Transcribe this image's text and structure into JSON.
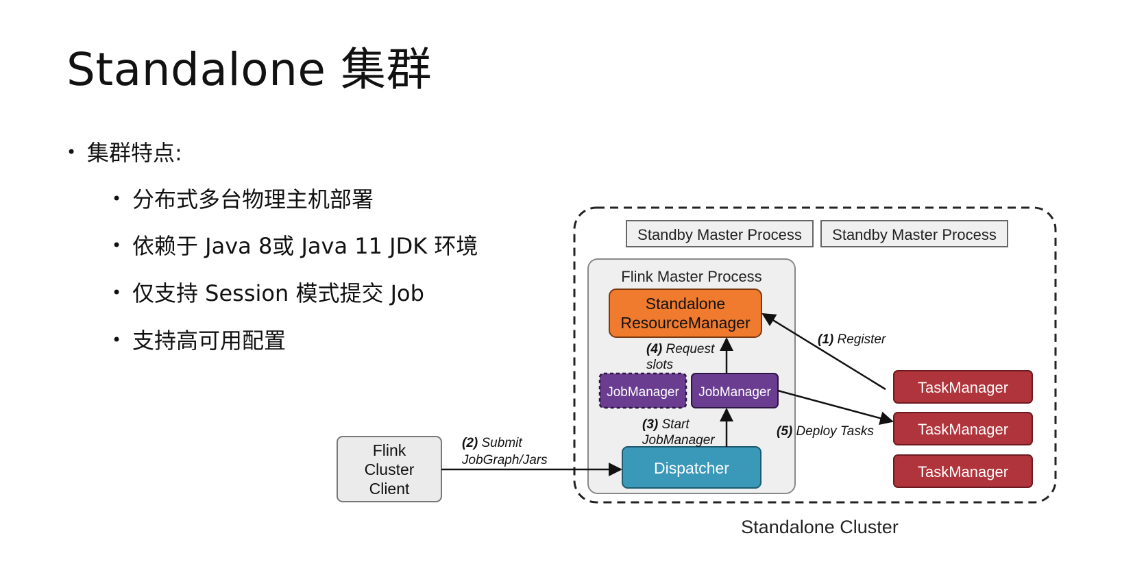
{
  "slide": {
    "title": "Standalone 集群",
    "bullets": [
      {
        "level": 1,
        "text": "集群特点:"
      },
      {
        "level": 2,
        "text": "分布式多台物理主机部署"
      },
      {
        "level": 2,
        "text": "依赖于 Java 8或 Java 11 JDK 环境"
      },
      {
        "level": 2,
        "text": "仅支持 Session 模式提交 Job"
      },
      {
        "level": 2,
        "text": "支持高可用配置"
      }
    ]
  },
  "diagram": {
    "cluster_label": "Standalone Cluster",
    "standby_1": "Standby Master Process",
    "standby_2": "Standby Master Process",
    "master_label": "Flink Master Process",
    "rm_line1": "Standalone",
    "rm_line2": "ResourceManager",
    "jm_dashed": "JobManager",
    "jm_active": "JobManager",
    "dispatcher": "Dispatcher",
    "client_line1": "Flink",
    "client_line2": "Cluster",
    "client_line3": "Client",
    "tm_1": "TaskManager",
    "tm_2": "TaskManager",
    "tm_3": "TaskManager",
    "edges": {
      "register_num": "(1)",
      "register_text": " Register",
      "submit_num": "(2)",
      "submit_text": " Submit",
      "submit_line2": "JobGraph/Jars",
      "start_num": "(3)",
      "start_text": " Start",
      "start_line2": "JobManager",
      "request_num": "(4)",
      "request_text": " Request",
      "request_line2": "slots",
      "deploy_num": "(5)",
      "deploy_text": " Deploy Tasks"
    },
    "colors": {
      "resource_manager": "#f07a2e",
      "job_manager": "#6a3d91",
      "dispatcher": "#3a98b9",
      "task_manager": "#b0343b",
      "panel": "#efefef"
    }
  }
}
